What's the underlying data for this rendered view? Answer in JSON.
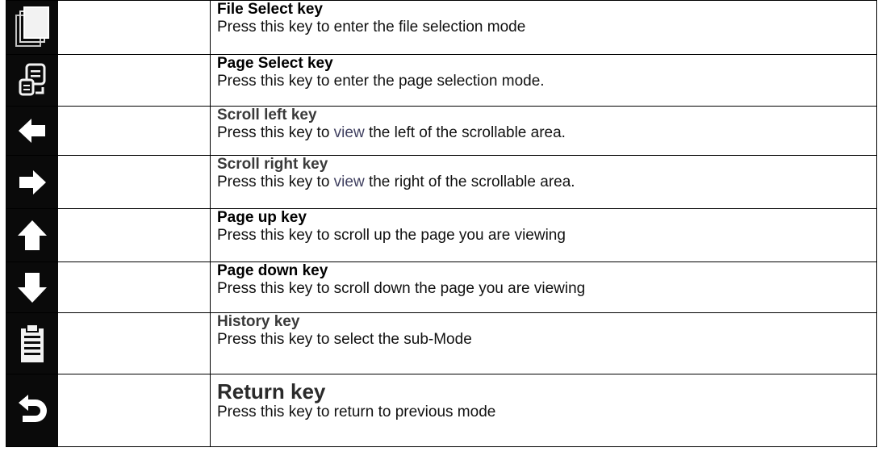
{
  "keys": [
    {
      "title": "File Select key",
      "desc": "Press this key to enter the file selection mode",
      "icon": "file-select-icon"
    },
    {
      "title": "Page Select key",
      "desc": "Press this key to enter the page selection mode.",
      "icon": "page-select-icon"
    },
    {
      "title": "Scroll left key",
      "desc_before": "Press this key to ",
      "desc_view": "view",
      "desc_after": " the left of the scrollable area.",
      "icon": "arrow-left-icon"
    },
    {
      "title": "Scroll right key",
      "desc_before": "Press this key to ",
      "desc_view": "view",
      "desc_after": " the right of the scrollable area.",
      "icon": "arrow-right-icon"
    },
    {
      "title": "Page up key",
      "desc": "Press this key to scroll up the page you are viewing",
      "icon": "arrow-up-icon"
    },
    {
      "title": "Page down key",
      "desc": "Press this key to scroll down the page you are viewing",
      "icon": "arrow-down-icon"
    },
    {
      "title": "History key",
      "desc": "Press this key to select the sub-Mode",
      "icon": "clipboard-icon"
    },
    {
      "title": "Return key",
      "desc": "Press this key to return to previous mode",
      "icon": "return-icon"
    }
  ]
}
